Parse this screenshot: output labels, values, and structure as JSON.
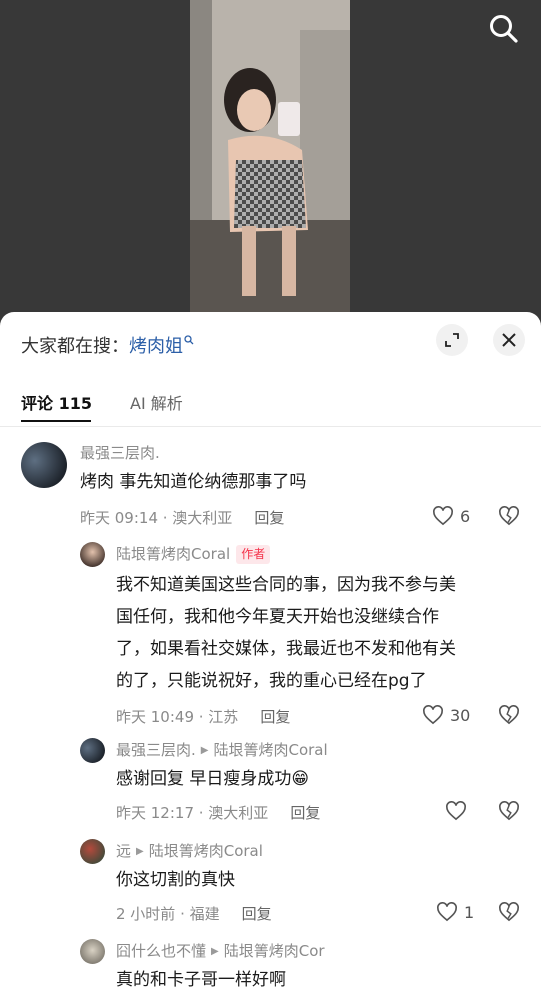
{
  "header": {
    "search_hint_label": "大家都在搜：",
    "search_hint_keyword": "烤肉姐"
  },
  "tabs": [
    {
      "label": "评论 115",
      "active": true
    },
    {
      "label": "AI 解析",
      "active": false
    }
  ],
  "comments": [
    {
      "user": "最强三层肉.",
      "text": "烤肉 事先知道伦纳德那事了吗",
      "time_location": "昨天 09:14 · 澳大利亚",
      "reply_label": "回复",
      "likes": "6"
    },
    {
      "user": "陆垠箐烤肉Coral",
      "badge": "作者",
      "text_lines": [
        "我不知道美国这些合同的事，因为我不参与美",
        "国任何，我和他今年夏天开始也没继续合作",
        "了，如果看社交媒体，我最近也不发和他有关",
        "的了，只能说祝好，我的重心已经在pg了"
      ],
      "time_location": "昨天 10:49 · 江苏",
      "reply_label": "回复",
      "likes": "30"
    },
    {
      "user": "最强三层肉.",
      "reply_to": "陆垠箐烤肉Coral",
      "text": "感谢回复 早日瘦身成功😁",
      "time_location": "昨天 12:17 · 澳大利亚",
      "reply_label": "回复",
      "likes": ""
    },
    {
      "user": "远",
      "reply_to": "陆垠箐烤肉Coral",
      "text": "你这切割的真快",
      "time_location": "2 小时前 · 福建",
      "reply_label": "回复",
      "likes": "1"
    },
    {
      "user": "囧什么也不懂",
      "reply_to": "陆垠箐烤肉Cor",
      "text": "真的和卡子哥一样好啊"
    }
  ],
  "colors": {
    "keyword": "#2c5fa8",
    "badge_text": "#f5334b",
    "badge_bg": "#fde7ea"
  }
}
